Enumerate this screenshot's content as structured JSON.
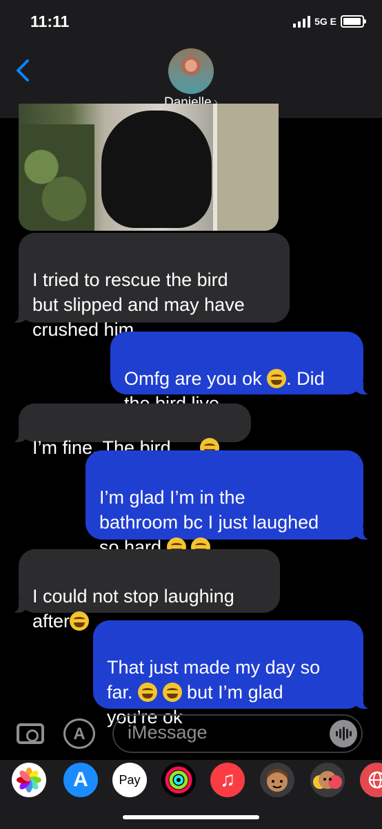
{
  "status": {
    "time": "11:11",
    "network": "5G E"
  },
  "header": {
    "contact_name": "Danielle",
    "chevron": "›"
  },
  "messages": [
    {
      "side": "in",
      "text": "I tried to rescue the bird\nbut slipped and may have\ncrushed him"
    },
    {
      "side": "out",
      "text_a": "Omfg are you ok ",
      "text_b": ". Did\nthe bird live"
    },
    {
      "side": "in",
      "text": "I’m fine. The bird….."
    },
    {
      "side": "out",
      "text": "I’m glad I’m in the\nbathroom bc I just laughed\nso hard "
    },
    {
      "side": "in",
      "text": "I could not stop laughing\nafter"
    },
    {
      "side": "out",
      "text_a": "That just made my day so\nfar. ",
      "text_b": " but I’m glad\nyou’re ok"
    }
  ],
  "input": {
    "placeholder": "iMessage"
  },
  "apps": [
    {
      "name": "photos-app-icon"
    },
    {
      "name": "app-store-app-icon",
      "glyph": "A"
    },
    {
      "name": "apple-pay-app-icon",
      "label": "Pay"
    },
    {
      "name": "activity-app-icon"
    },
    {
      "name": "music-app-icon",
      "glyph": "♫"
    },
    {
      "name": "memoji-app-icon"
    },
    {
      "name": "memoji-stickers-app-icon"
    },
    {
      "name": "web-images-app-icon"
    }
  ],
  "colors": {
    "outgoing": "#1f3fd1",
    "incoming": "#2c2c2e",
    "header": "#1c1c1e"
  }
}
